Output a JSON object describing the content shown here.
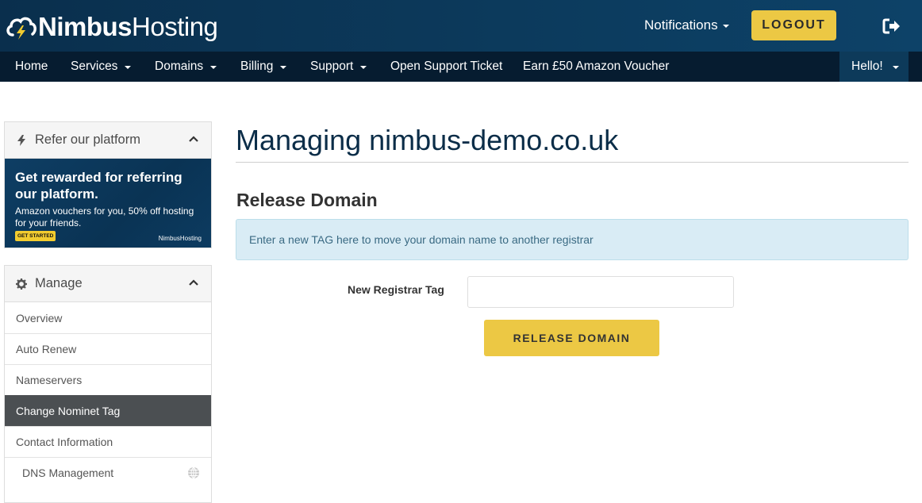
{
  "header": {
    "logo_bold": "Nimbus",
    "logo_regular": "Hosting",
    "notifications_label": "Notifications",
    "logout_label": "LOGOUT",
    "accent_color": "#ecc844",
    "icons": {
      "logo": "cloud-lightning-icon",
      "exit": "sign-out-icon"
    }
  },
  "nav": {
    "items": [
      {
        "label": "Home"
      },
      {
        "label": "Services"
      },
      {
        "label": "Domains"
      },
      {
        "label": "Billing"
      },
      {
        "label": "Support"
      },
      {
        "label": "Open Support Ticket"
      },
      {
        "label": "Earn £50 Amazon Voucher"
      }
    ],
    "hello_label": "Hello!"
  },
  "sidebar": {
    "refer": {
      "title": "Refer our platform",
      "banner_headline": "Get rewarded for referring our platform.",
      "banner_sub": "Amazon vouchers for you, 50% off hosting for your friends.",
      "banner_cta": "GET STARTED",
      "banner_logo": "NimbusHosting"
    },
    "manage": {
      "title": "Manage",
      "items": [
        {
          "label": "Overview"
        },
        {
          "label": "Auto Renew"
        },
        {
          "label": "Nameservers"
        },
        {
          "label": "Change Nominet Tag",
          "active": true
        },
        {
          "label": "Contact Information"
        },
        {
          "label": "DNS Management"
        }
      ]
    }
  },
  "main": {
    "page_title": "Managing nimbus-demo.co.uk",
    "section_title": "Release Domain",
    "info_text": "Enter a new TAG here to move your domain name to another registrar",
    "field_label": "New Registrar Tag",
    "field_value": "",
    "field_placeholder": "",
    "release_button": "RELEASE DOMAIN"
  }
}
